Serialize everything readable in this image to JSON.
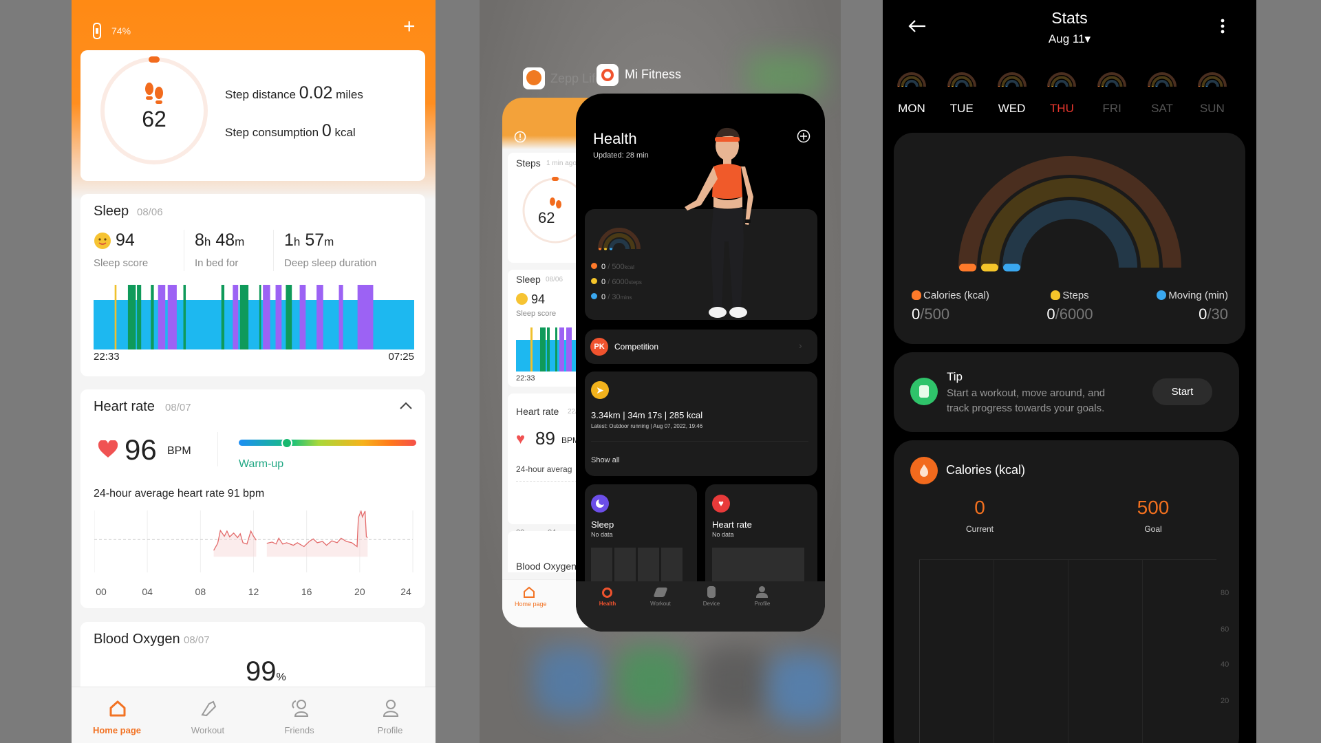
{
  "left_app": {
    "battery": "74%",
    "add_icon": "plus-icon",
    "steps": {
      "count": "62",
      "distance_label": "Step distance",
      "distance_value": "0.02",
      "distance_unit": "miles",
      "consumption_label": "Step consumption",
      "consumption_value": "0",
      "consumption_unit": "kcal"
    },
    "sleep": {
      "title": "Sleep",
      "date": "08/06",
      "score": "94",
      "score_label": "Sleep score",
      "bed_h": "8",
      "bed_m": "48",
      "bed_label": "In bed for",
      "deep_h": "1",
      "deep_m": "57",
      "deep_label": "Deep sleep duration",
      "h_unit": "h",
      "m_unit": "m",
      "start": "22:33",
      "end": "07:25",
      "total_minutes": 532,
      "colors": {
        "light": "#1db8f0",
        "deep": "#0f9a5a",
        "rem": "#9c62f4",
        "awake": "#f0c02c"
      },
      "segments": [
        [
          "awake",
          35,
          3
        ],
        [
          "deep",
          57,
          13
        ],
        [
          "deep",
          72,
          7
        ],
        [
          "deep",
          95,
          5
        ],
        [
          "rem",
          107,
          12
        ],
        [
          "rem",
          123,
          15
        ],
        [
          "deep",
          149,
          4
        ],
        [
          "deep",
          212,
          5
        ],
        [
          "rem",
          231,
          9
        ],
        [
          "deep",
          243,
          14
        ],
        [
          "deep",
          275,
          3
        ],
        [
          "rem",
          281,
          12
        ],
        [
          "rem",
          302,
          10
        ],
        [
          "deep",
          319,
          10
        ],
        [
          "rem",
          342,
          10
        ],
        [
          "rem",
          370,
          11
        ],
        [
          "rem",
          407,
          7
        ],
        [
          "rem",
          438,
          26
        ]
      ]
    },
    "heart": {
      "title": "Heart rate",
      "date": "08/07",
      "value": "96",
      "unit": "BPM",
      "zone": "Warm-up",
      "zone_position": 0.27,
      "average_text": "24-hour average heart rate 91 bpm",
      "average": 91,
      "x_ticks": [
        "00",
        "04",
        "08",
        "12",
        "16",
        "20",
        "24"
      ],
      "ylim": [
        40,
        136
      ],
      "series": [
        [
          9.0,
          74
        ],
        [
          9.3,
          85
        ],
        [
          9.5,
          105
        ],
        [
          9.8,
          96
        ],
        [
          10.0,
          104
        ],
        [
          10.2,
          95
        ],
        [
          10.5,
          101
        ],
        [
          10.8,
          94
        ],
        [
          11.0,
          100
        ],
        [
          11.2,
          86
        ],
        [
          11.5,
          84
        ],
        [
          11.8,
          104
        ],
        [
          12.0,
          96
        ],
        [
          12.2,
          90
        ],
        null,
        [
          13.0,
          85
        ],
        [
          13.4,
          87
        ],
        [
          13.7,
          84
        ],
        [
          13.9,
          93
        ],
        [
          14.2,
          84
        ],
        [
          14.5,
          86
        ],
        [
          15.0,
          82
        ],
        [
          15.3,
          86
        ],
        [
          15.8,
          80
        ],
        [
          16.2,
          88
        ],
        [
          16.5,
          92
        ],
        [
          16.8,
          86
        ],
        [
          17.2,
          88
        ],
        [
          17.5,
          82
        ],
        [
          17.9,
          89
        ],
        [
          18.3,
          86
        ],
        [
          18.6,
          93
        ],
        [
          19.0,
          88
        ],
        [
          19.4,
          86
        ],
        [
          19.8,
          80
        ],
        [
          19.9,
          125
        ],
        [
          20.1,
          135
        ],
        [
          20.2,
          126
        ],
        [
          20.4,
          135
        ],
        [
          20.5,
          95
        ],
        [
          20.6,
          94
        ]
      ]
    },
    "blood_oxygen": {
      "title": "Blood Oxygen",
      "date": "08/07",
      "value": "99",
      "unit": "%"
    },
    "nav": [
      {
        "label": "Home page",
        "icon": "home-icon",
        "active": true
      },
      {
        "label": "Workout",
        "icon": "shoe-icon"
      },
      {
        "label": "Friends",
        "icon": "friends-icon"
      },
      {
        "label": "Profile",
        "icon": "profile-icon"
      }
    ],
    "accent": "#ff7a1a"
  },
  "switcher": {
    "zepp": {
      "title": "Zepp Life",
      "steps_label": "Steps",
      "steps_time": "1 min ago",
      "steps": "62",
      "sleep": "Sleep",
      "sleep_date": "08/06",
      "score": "94",
      "score_label": "Sleep score",
      "time": "22:33",
      "heart": "Heart rate",
      "heart_date": "22/",
      "bpm": "89",
      "bpm_unit": "BPM",
      "average": "24-hour averag",
      "ticks": [
        "00",
        "04"
      ],
      "blood": "Blood Oxygen",
      "nav_home": "Home page"
    },
    "mifit": {
      "app_name": "Mi Fitness",
      "title": "Health",
      "updated": "Updated: 28 min",
      "rows": [
        {
          "icon": "flame-icon",
          "value": "0",
          "goal": "500",
          "unit": "kcal"
        },
        {
          "icon": "shoe-icon",
          "value": "0",
          "goal": "6000",
          "unit": "steps"
        },
        {
          "icon": "clock-icon",
          "value": "0",
          "goal": "30",
          "unit": "mins"
        }
      ],
      "competition_badge": "PK",
      "competition": "Competition",
      "workout_summary": "3.34km | 34m 17s | 285 kcal",
      "workout_latest": "Latest: Outdoor running | Aug 07, 2022, 19:46",
      "show_all": "Show all",
      "sleep": "Sleep",
      "sleep_status": "No data",
      "heart": "Heart rate",
      "heart_status": "No data",
      "nav": [
        {
          "label": "Health",
          "active": true
        },
        {
          "label": "Workout"
        },
        {
          "label": "Device"
        },
        {
          "label": "Profile"
        }
      ]
    }
  },
  "stats": {
    "title": "Stats",
    "date": "Aug 11▾",
    "days": [
      {
        "d": "MON",
        "state": "past"
      },
      {
        "d": "TUE",
        "state": "past"
      },
      {
        "d": "WED",
        "state": "past"
      },
      {
        "d": "THU",
        "state": "today"
      },
      {
        "d": "FRI",
        "state": "future"
      },
      {
        "d": "SAT",
        "state": "future"
      },
      {
        "d": "SUN",
        "state": "future"
      }
    ],
    "metrics": [
      {
        "label": "Calories (kcal)",
        "icon": "flame-icon",
        "value": "0",
        "goal": "/500",
        "progress": 0,
        "color": "#ff7a2a",
        "track": "#4a2e1f"
      },
      {
        "label": "Steps",
        "icon": "shoe-icon",
        "value": "0",
        "goal": "/6000",
        "progress": 0,
        "color": "#f5c52a",
        "track": "#4a3a16"
      },
      {
        "label": "Moving (min)",
        "icon": "clock-icon",
        "value": "0",
        "goal": "/30",
        "progress": 0,
        "color": "#3aa8f0",
        "track": "#233848"
      }
    ],
    "tip": {
      "title": "Tip",
      "text1": "Start a workout, move around, and",
      "text2": "track progress towards your goals.",
      "button": "Start"
    },
    "calories": {
      "title": "Calories (kcal)",
      "current": "0",
      "current_label": "Current",
      "goal": "500",
      "goal_label": "Goal",
      "y_ticks": [
        "80",
        "60",
        "40",
        "20"
      ]
    }
  }
}
